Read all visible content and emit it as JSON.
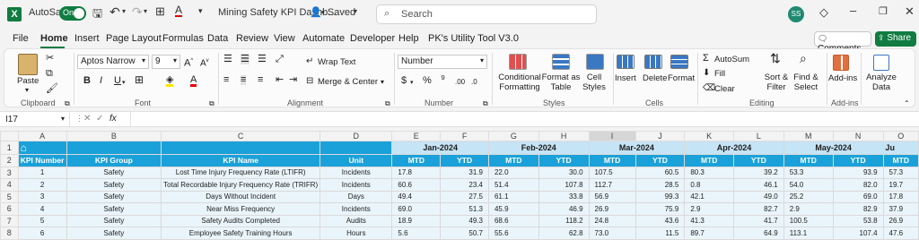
{
  "titlebar": {
    "autosave": "AutoSave",
    "toggle": "On",
    "filename": "Mining Safety KPI Dashb...",
    "saved": "• Saved",
    "search_placeholder": "Search",
    "user_initials": "SS"
  },
  "menu": [
    "File",
    "Home",
    "Insert",
    "Page Layout",
    "Formulas",
    "Data",
    "Review",
    "View",
    "Automate",
    "Developer",
    "Help",
    "PK's Utility Tool V3.0"
  ],
  "comments_label": "Comments",
  "share_label": "Share",
  "ribbon": {
    "paste": "Paste",
    "clipboard": "Clipboard",
    "font_name": "Aptos Narrow",
    "font_size": "9",
    "font": "Font",
    "wrap_text": "Wrap Text",
    "merge_center": "Merge & Center",
    "alignment": "Alignment",
    "number_format": "Number",
    "number": "Number",
    "cond_format": "Conditional Formatting",
    "format_table": "Format as Table",
    "cell_styles": "Cell Styles",
    "styles": "Styles",
    "insert": "Insert",
    "delete": "Delete",
    "format": "Format",
    "cells": "Cells",
    "autosum": "AutoSum",
    "fill": "Fill",
    "clear": "Clear",
    "sort_filter": "Sort & Filter",
    "find_select": "Find & Select",
    "editing": "Editing",
    "addins": "Add-ins",
    "addins_group": "Add-ins",
    "analyze": "Analyze Data"
  },
  "formula": {
    "cell_ref": "I17",
    "fx": "fx"
  },
  "grid": {
    "columns": [
      "A",
      "B",
      "C",
      "D",
      "E",
      "F",
      "G",
      "H",
      "I",
      "J",
      "K",
      "L",
      "M",
      "N",
      "O"
    ],
    "rows": [
      "1",
      "2",
      "3",
      "4",
      "5",
      "6",
      "7",
      "8"
    ],
    "months": [
      "Jan-2024",
      "Feb-2024",
      "Mar-2024",
      "Apr-2024",
      "May-2024",
      "Ju"
    ],
    "headers": [
      "KPI Number",
      "KPI Group",
      "KPI Name",
      "Unit"
    ],
    "sub": [
      "MTD",
      "YTD"
    ],
    "data": [
      {
        "n": "1",
        "g": "Safety",
        "name": "Lost Time Injury Frequency Rate (LTIFR)",
        "u": "Incidents",
        "v": [
          "17.8",
          "31.9",
          "22.0",
          "30.0",
          "107.5",
          "60.5",
          "80.3",
          "39.2",
          "53.3",
          "93.9",
          "57.3"
        ]
      },
      {
        "n": "2",
        "g": "Safety",
        "name": "Total Recordable Injury Frequency Rate (TRIFR)",
        "u": "Incidents",
        "v": [
          "60.6",
          "23.4",
          "51.4",
          "107.8",
          "112.7",
          "28.5",
          "0.8",
          "46.1",
          "54.0",
          "82.0",
          "19.7"
        ]
      },
      {
        "n": "3",
        "g": "Safety",
        "name": "Days Without Incident",
        "u": "Days",
        "v": [
          "49.4",
          "27.5",
          "61.1",
          "33.8",
          "56.9",
          "99.3",
          "42.1",
          "49.0",
          "25.2",
          "69.0",
          "17.8"
        ]
      },
      {
        "n": "4",
        "g": "Safety",
        "name": "Near Miss Frequency",
        "u": "Incidents",
        "v": [
          "69.0",
          "51.3",
          "45.9",
          "46.9",
          "26.9",
          "75.9",
          "2.9",
          "82.7",
          "2.9",
          "82.9",
          "37.9"
        ]
      },
      {
        "n": "5",
        "g": "Safety",
        "name": "Safety Audits Completed",
        "u": "Audits",
        "v": [
          "18.9",
          "49.3",
          "68.6",
          "118.2",
          "24.8",
          "43.6",
          "41.3",
          "41.7",
          "100.5",
          "53.8",
          "26.9"
        ]
      },
      {
        "n": "6",
        "g": "Safety",
        "name": "Employee Safety Training Hours",
        "u": "Hours",
        "v": [
          "5.6",
          "50.7",
          "55.6",
          "62.8",
          "73.0",
          "11.5",
          "89.7",
          "64.9",
          "113.1",
          "107.4",
          "47.6"
        ]
      }
    ]
  },
  "colors": {
    "header_blue": "#1ba1d9",
    "month_bg": "#c5e4f5",
    "excel_green": "#107c41"
  }
}
